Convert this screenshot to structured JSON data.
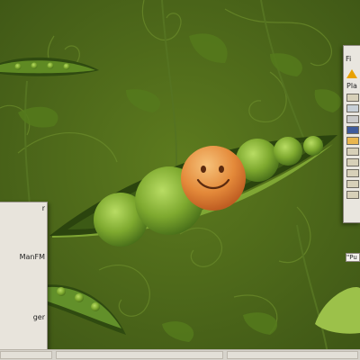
{
  "desktop": {
    "wallpaper": "Pea pod with smiling pea on green background",
    "colors": {
      "bg": "#456019",
      "pea": "#6f9725",
      "pea_light": "#9bc43f",
      "pod": "#2f4a10",
      "smile": "#e88d3b"
    }
  },
  "side_menu": {
    "items": [
      "r",
      "ManFM",
      "ger"
    ]
  },
  "file_window": {
    "title_fragment": "Fi",
    "places_fragment": "Pla",
    "path_fragment": "\"Pu",
    "warning_icon": "warning-icon"
  },
  "taskbar": {}
}
